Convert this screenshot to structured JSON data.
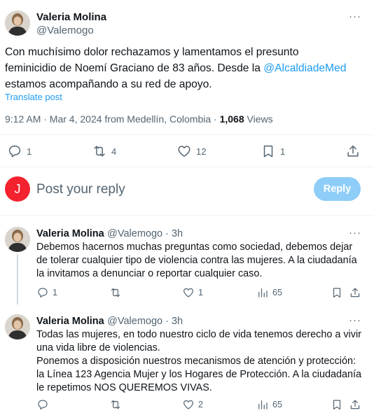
{
  "tweet": {
    "author_name": "Valeria Molina",
    "author_handle": "@Valemogo",
    "more_label": "···",
    "text_before": "Con muchísimo dolor rechazamos y lamentamos el presunto feminicidio de Noemí Graciano de 83 años. Desde la ",
    "mention": "@AlcaldiadeMed",
    "text_after": " estamos acompañando a su red de apoyo.",
    "translate": "Translate post",
    "time": "9:12 AM · Mar 4, 2024 from Medellín, Colombia · ",
    "views_count": "1,068",
    "views_label": " Views",
    "replies": "1",
    "reposts": "4",
    "likes": "12",
    "bookmarks": "1"
  },
  "composer": {
    "avatar_letter": "J",
    "avatar_color": "#f4212e",
    "placeholder": "Post your reply",
    "reply_button": "Reply"
  },
  "replies": [
    {
      "name": "Valeria Molina",
      "handle": "@Valemogo · 3h",
      "text": "Debemos hacernos muchas preguntas como sociedad, debemos dejar de tolerar cualquier tipo de violencia contra las mujeres. A la ciudadanía la invitamos a denunciar o reportar cualquier caso.",
      "replies": "1",
      "reposts": "",
      "likes": "1",
      "views": "65"
    },
    {
      "name": "Valeria Molina",
      "handle": "@Valemogo · 3h",
      "text": "Todas las mujeres, en todo nuestro ciclo de vida tenemos derecho a vivir una vida libre de violencias.\nPonemos a disposición nuestros mecanismos de atención y protección: la Línea 123 Agencia Mujer y los Hogares de Protección. A la ciudadanía le repetimos NOS QUEREMOS VIVAS.",
      "replies": "",
      "reposts": "",
      "likes": "2",
      "views": "65"
    }
  ],
  "colors": {
    "accent": "#1d9bf0",
    "muted": "#536471",
    "reply_button": "#8ecdf8"
  }
}
